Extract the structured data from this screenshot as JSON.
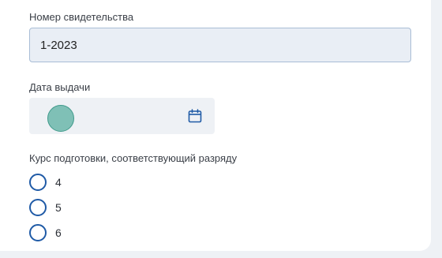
{
  "certificate_number": {
    "label": "Номер свидетельства",
    "value": "1-2023"
  },
  "issue_date": {
    "label": "Дата выдачи",
    "value": "",
    "icon": "calendar-icon"
  },
  "training_course": {
    "label": "Курс подготовки, соответствующий разряду",
    "options": [
      {
        "label": "4",
        "selected": false
      },
      {
        "label": "5",
        "selected": false
      },
      {
        "label": "6",
        "selected": false
      }
    ]
  },
  "colors": {
    "accent": "#1f5aa6",
    "input_bg": "#e9eef5",
    "input_border": "#a9bdd6"
  }
}
